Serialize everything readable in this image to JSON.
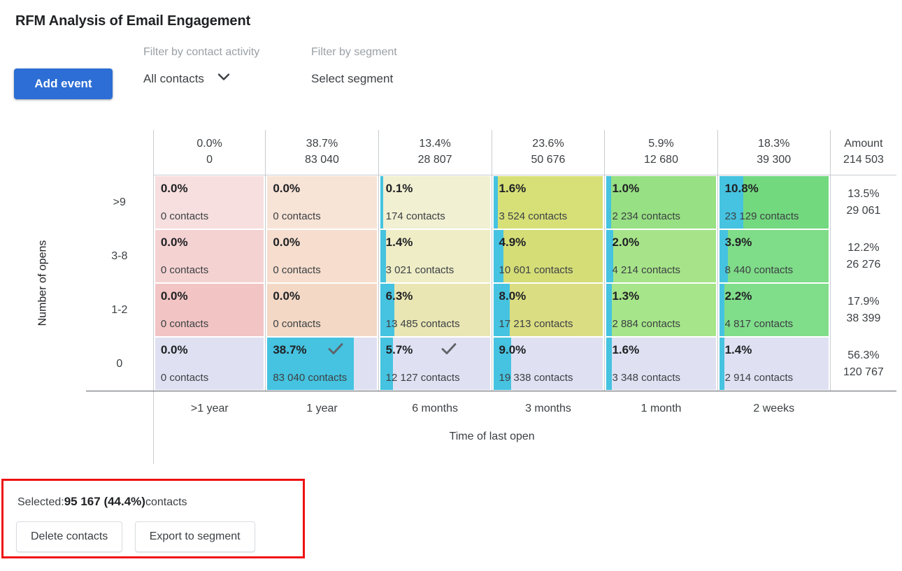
{
  "page_title": "RFM Analysis of Email Engagement",
  "toolbar": {
    "add_event_label": "Add event",
    "activity_filter_label": "Filter by contact activity",
    "activity_filter_value": "All contacts",
    "segment_filter_label": "Filter by segment",
    "segment_filter_value": "Select segment"
  },
  "chart_data": {
    "type": "heatmap",
    "title": "RFM Analysis of Email Engagement",
    "xlabel": "Time of last open",
    "ylabel": "Number of opens",
    "x_categories": [
      ">1 year",
      "1 year",
      "6 months",
      "3 months",
      "1 month",
      "2 weeks"
    ],
    "y_categories": [
      ">9",
      "3-8",
      "1-2",
      "0"
    ],
    "column_totals": [
      {
        "pct": "0.0%",
        "count": "0"
      },
      {
        "pct": "38.7%",
        "count": "83 040"
      },
      {
        "pct": "13.4%",
        "count": "28 807"
      },
      {
        "pct": "23.6%",
        "count": "50 676"
      },
      {
        "pct": "5.9%",
        "count": "12 680"
      },
      {
        "pct": "18.3%",
        "count": "39 300"
      }
    ],
    "corner_header": {
      "label": "Amount",
      "total": "214 503"
    },
    "row_totals": [
      {
        "pct": "13.5%",
        "count": "29 061"
      },
      {
        "pct": "12.2%",
        "count": "26 276"
      },
      {
        "pct": "17.9%",
        "count": "38 399"
      },
      {
        "pct": "56.3%",
        "count": "120 767"
      }
    ],
    "rows": [
      {
        "label": ">9",
        "cells": [
          {
            "pct": "0.0%",
            "count": "0 contacts",
            "value": 0.0,
            "bg": "#f7dfdf",
            "bar": 0,
            "selected": false,
            "checked": false
          },
          {
            "pct": "0.0%",
            "count": "0 contacts",
            "value": 0.0,
            "bg": "#f8e3d7",
            "bar": 0,
            "selected": false,
            "checked": false
          },
          {
            "pct": "0.1%",
            "count": "174 contacts",
            "value": 0.1,
            "bg": "#f1f0d2",
            "bar": 3,
            "selected": false,
            "checked": false
          },
          {
            "pct": "1.6%",
            "count": "3 524 contacts",
            "value": 1.6,
            "bg": "#d7e077",
            "bar": 4,
            "selected": false,
            "checked": false
          },
          {
            "pct": "1.0%",
            "count": "2 234 contacts",
            "value": 1.0,
            "bg": "#97e083",
            "bar": 4,
            "selected": false,
            "checked": false
          },
          {
            "pct": "10.8%",
            "count": "23 129 contacts",
            "value": 10.8,
            "bg": "#73d97f",
            "bar": 22,
            "selected": false,
            "checked": false
          }
        ]
      },
      {
        "label": "3-8",
        "cells": [
          {
            "pct": "0.0%",
            "count": "0 contacts",
            "value": 0.0,
            "bg": "#f5d2d2",
            "bar": 0,
            "selected": false,
            "checked": false
          },
          {
            "pct": "0.0%",
            "count": "0 contacts",
            "value": 0.0,
            "bg": "#f6ddcd",
            "bar": 0,
            "selected": false,
            "checked": false
          },
          {
            "pct": "1.4%",
            "count": "3 021 contacts",
            "value": 1.4,
            "bg": "#eeedc6",
            "bar": 5,
            "selected": false,
            "checked": false
          },
          {
            "pct": "4.9%",
            "count": "10 601 contacts",
            "value": 4.9,
            "bg": "#d5dd77",
            "bar": 9,
            "selected": false,
            "checked": false
          },
          {
            "pct": "2.0%",
            "count": "4 214 contacts",
            "value": 2.0,
            "bg": "#a7e489",
            "bar": 6,
            "selected": false,
            "checked": false
          },
          {
            "pct": "3.9%",
            "count": "8 440 contacts",
            "value": 3.9,
            "bg": "#7fdc88",
            "bar": 8,
            "selected": false,
            "checked": false
          }
        ]
      },
      {
        "label": "1-2",
        "cells": [
          {
            "pct": "0.0%",
            "count": "0 contacts",
            "value": 0.0,
            "bg": "#f2c4c4",
            "bar": 0,
            "selected": false,
            "checked": false
          },
          {
            "pct": "0.0%",
            "count": "0 contacts",
            "value": 0.0,
            "bg": "#f3d8c5",
            "bar": 0,
            "selected": false,
            "checked": false
          },
          {
            "pct": "6.3%",
            "count": "13 485 contacts",
            "value": 6.3,
            "bg": "#e9e6b4",
            "bar": 13,
            "selected": false,
            "checked": false
          },
          {
            "pct": "8.0%",
            "count": "17 213 contacts",
            "value": 8.0,
            "bg": "#dbdd82",
            "bar": 15,
            "selected": false,
            "checked": false
          },
          {
            "pct": "1.3%",
            "count": "2 884 contacts",
            "value": 1.3,
            "bg": "#a6e589",
            "bar": 5,
            "selected": false,
            "checked": false
          },
          {
            "pct": "2.2%",
            "count": "4 817 contacts",
            "value": 2.2,
            "bg": "#80dd8a",
            "bar": 5,
            "selected": false,
            "checked": false
          }
        ]
      },
      {
        "label": "0",
        "cells": [
          {
            "pct": "0.0%",
            "count": "0 contacts",
            "value": 0.0,
            "bg": "#dfe1f2",
            "bar": 0,
            "selected": true,
            "checked": false
          },
          {
            "pct": "38.7%",
            "count": "83 040 contacts",
            "value": 38.7,
            "bg": "#dfe1f2",
            "bar": 79,
            "selected": true,
            "checked": true
          },
          {
            "pct": "5.7%",
            "count": "12 127 contacts",
            "value": 5.7,
            "bg": "#dfe1f2",
            "bar": 12,
            "selected": true,
            "checked": true
          },
          {
            "pct": "9.0%",
            "count": "19 338 contacts",
            "value": 9.0,
            "bg": "#dfe1f2",
            "bar": 16,
            "selected": true,
            "checked": false
          },
          {
            "pct": "1.6%",
            "count": "3 348 contacts",
            "value": 1.6,
            "bg": "#dfe1f2",
            "bar": 5,
            "selected": true,
            "checked": false
          },
          {
            "pct": "1.4%",
            "count": "2 914 contacts",
            "value": 1.4,
            "bg": "#dfe1f2",
            "bar": 5,
            "selected": true,
            "checked": false
          }
        ]
      }
    ]
  },
  "selection": {
    "prefix": "Selected:",
    "value": "95 167 (44.4%)",
    "suffix": "contacts",
    "delete_label": "Delete contacts",
    "export_label": "Export to segment"
  },
  "colors": {
    "accent_blue": "#2c6ed5",
    "bar_cyan": "#45c3e0",
    "selected_bg": "#dfe1f2",
    "highlight_border": "#ee1111"
  }
}
